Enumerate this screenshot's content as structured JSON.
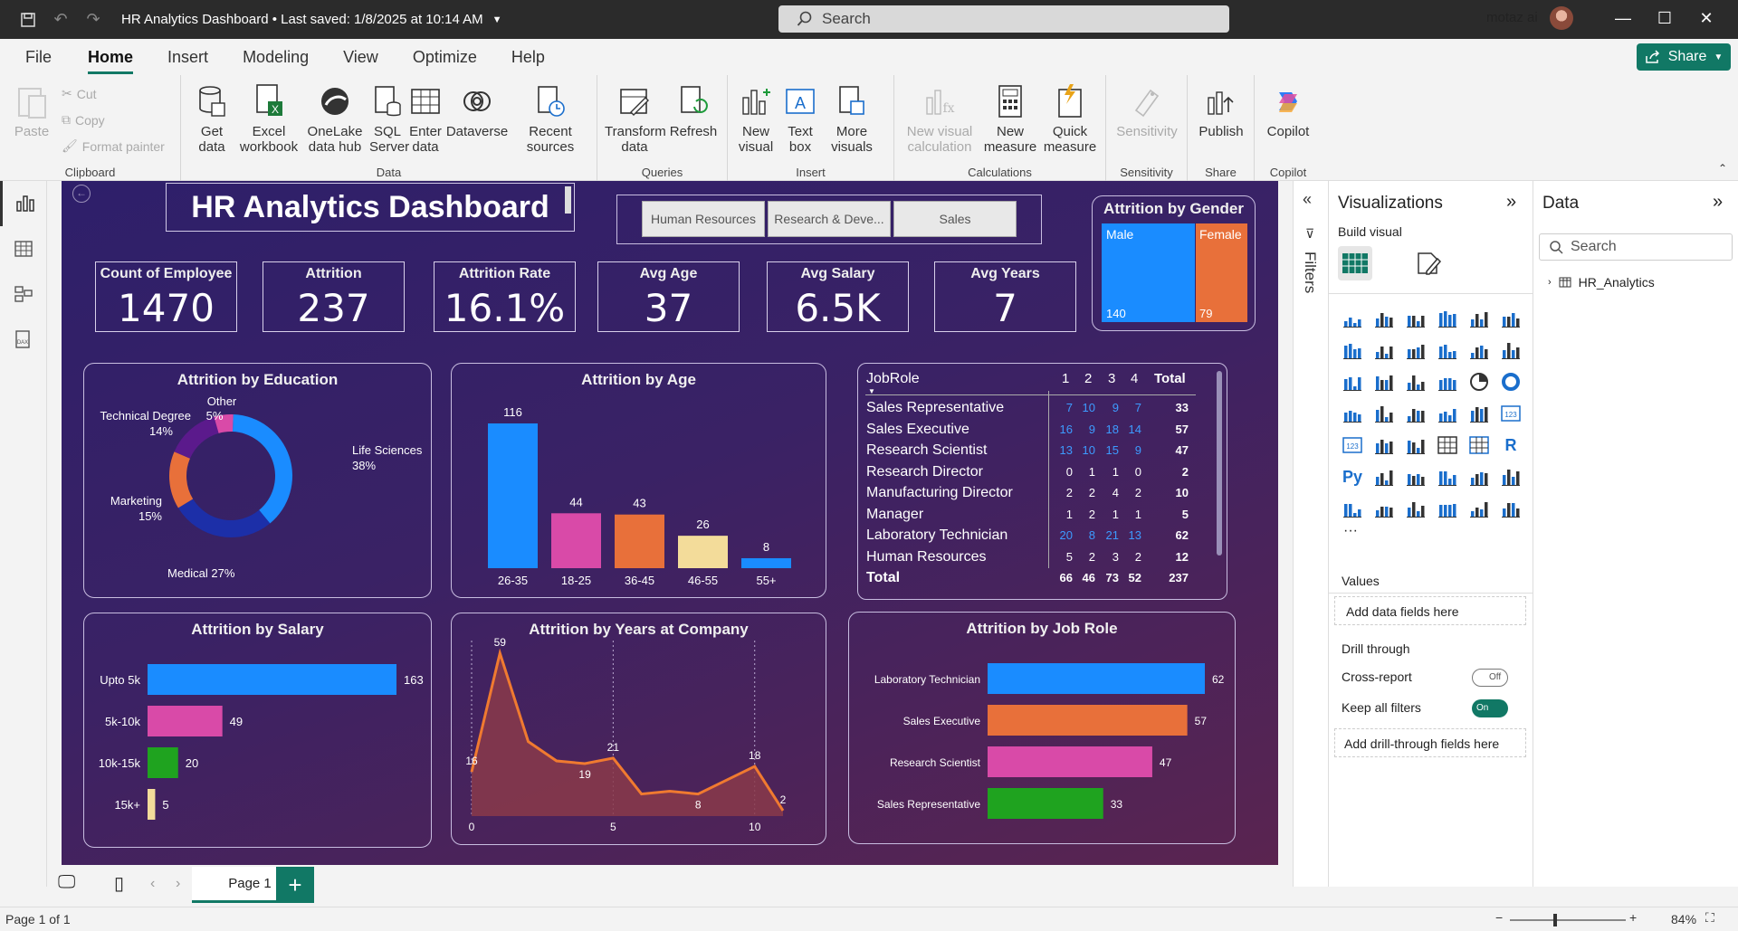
{
  "titlebar": {
    "title": "HR Analytics Dashboard • Last saved: 1/8/2025 at 10:14 AM",
    "search_placeholder": "Search",
    "user": "motaz ai"
  },
  "menu": {
    "file": "File",
    "home": "Home",
    "insert": "Insert",
    "modeling": "Modeling",
    "view": "View",
    "optimize": "Optimize",
    "help": "Help",
    "share": "Share"
  },
  "ribbon": {
    "clipboard": {
      "label": "Clipboard",
      "paste": "Paste",
      "cut": "Cut",
      "copy": "Copy",
      "format_painter": "Format painter"
    },
    "data": {
      "label": "Data",
      "get_data": "Get data",
      "excel": "Excel workbook",
      "onelake": "OneLake data hub",
      "sql": "SQL Server",
      "enter": "Enter data",
      "dataverse": "Dataverse",
      "recent": "Recent sources"
    },
    "queries": {
      "label": "Queries",
      "transform": "Transform data",
      "refresh": "Refresh"
    },
    "insert": {
      "label": "Insert",
      "new_visual": "New visual",
      "text_box": "Text box",
      "more_visuals": "More visuals"
    },
    "calculations": {
      "label": "Calculations",
      "new_visual_calc": "New visual calculation",
      "new_measure": "New measure",
      "quick_measure": "Quick measure"
    },
    "sensitivity": {
      "label": "Sensitivity",
      "sensitivity": "Sensitivity"
    },
    "share": {
      "label": "Share",
      "publish": "Publish"
    },
    "copilot": {
      "label": "Copilot",
      "copilot": "Copilot"
    }
  },
  "dashboard": {
    "title": "HR Analytics Dashboard",
    "slicers": [
      "Human Resources",
      "Research & Deve...",
      "Sales"
    ],
    "kpis": [
      {
        "label": "Count of Employee",
        "value": "1470"
      },
      {
        "label": "Attrition",
        "value": "237"
      },
      {
        "label": "Attrition Rate",
        "value": "16.1%"
      },
      {
        "label": "Avg Age",
        "value": "37"
      },
      {
        "label": "Avg Salary",
        "value": "6.5K"
      },
      {
        "label": "Avg Years",
        "value": "7"
      }
    ],
    "gender": {
      "title": "Attrition by Gender",
      "male_label": "Male",
      "male_value": "140",
      "female_label": "Female",
      "female_value": "79",
      "male_color": "#1a8cff",
      "female_color": "#e8703a"
    },
    "education_title": "Attrition by Education",
    "age_title": "Attrition by Age",
    "salary_title": "Attrition by Salary",
    "years_title": "Attrition by Years at Company",
    "jobrole_title": "Attrition by Job Role",
    "matrix": {
      "col_jobrole": "JobRole",
      "cols": [
        "1",
        "2",
        "3",
        "4",
        "Total"
      ],
      "rows": [
        {
          "role": "Sales Representative",
          "v": [
            "7",
            "10",
            "9",
            "7",
            "33"
          ]
        },
        {
          "role": "Sales Executive",
          "v": [
            "16",
            "9",
            "18",
            "14",
            "57"
          ]
        },
        {
          "role": "Research Scientist",
          "v": [
            "13",
            "10",
            "15",
            "9",
            "47"
          ]
        },
        {
          "role": "Research Director",
          "v": [
            "0",
            "1",
            "1",
            "0",
            "2"
          ]
        },
        {
          "role": "Manufacturing Director",
          "v": [
            "2",
            "2",
            "4",
            "2",
            "10"
          ]
        },
        {
          "role": "Manager",
          "v": [
            "1",
            "2",
            "1",
            "1",
            "5"
          ]
        },
        {
          "role": "Laboratory Technician",
          "v": [
            "20",
            "8",
            "21",
            "13",
            "62"
          ]
        },
        {
          "role": "Human Resources",
          "v": [
            "5",
            "2",
            "3",
            "2",
            "12"
          ]
        }
      ],
      "total_label": "Total",
      "totals": [
        "66",
        "46",
        "73",
        "52",
        "237"
      ]
    }
  },
  "chart_data": [
    {
      "type": "pie",
      "title": "Attrition by Education",
      "categories": [
        "Life Sciences",
        "Medical",
        "Marketing",
        "Technical Degree",
        "Other"
      ],
      "values": [
        38,
        27,
        15,
        14,
        5
      ],
      "labels": [
        "Life Sciences 38%",
        "Medical 27%",
        "Marketing 15%",
        "Technical Degree 14%",
        "Other 5%"
      ],
      "colors": [
        "#1a8cff",
        "#1c2fa8",
        "#e8703a",
        "#5b1a8c",
        "#d94aa8"
      ]
    },
    {
      "type": "bar",
      "title": "Attrition by Age",
      "categories": [
        "26-35",
        "18-25",
        "36-45",
        "46-55",
        "55+"
      ],
      "values": [
        116,
        44,
        43,
        26,
        8
      ],
      "colors": [
        "#1a8cff",
        "#d94aa8",
        "#e8703a",
        "#f3dc9a",
        "#1a8cff"
      ]
    },
    {
      "type": "bar",
      "orientation": "horizontal",
      "title": "Attrition by Salary",
      "categories": [
        "Upto 5k",
        "5k-10k",
        "10k-15k",
        "15k+"
      ],
      "values": [
        163,
        49,
        20,
        5
      ],
      "colors": [
        "#1a8cff",
        "#d94aa8",
        "#1fa31f",
        "#f3dc9a"
      ]
    },
    {
      "type": "area",
      "title": "Attrition by Years at Company",
      "x": [
        0,
        1,
        2,
        3,
        4,
        5,
        6,
        7,
        8,
        9,
        10,
        11
      ],
      "values": [
        16,
        59,
        27,
        20,
        19,
        21,
        8,
        9,
        8,
        13,
        18,
        2
      ],
      "x_ticks": [
        "0",
        "5",
        "10"
      ],
      "labeled": {
        "0": "16",
        "1": "59",
        "4": "19",
        "5": "21",
        "8": "8",
        "10": "18",
        "11": "2"
      }
    },
    {
      "type": "bar",
      "orientation": "horizontal",
      "title": "Attrition by Job Role",
      "categories": [
        "Laboratory Technician",
        "Sales Executive",
        "Research Scientist",
        "Sales Representative"
      ],
      "values": [
        62,
        57,
        47,
        33
      ],
      "colors": [
        "#1a8cff",
        "#e8703a",
        "#d94aa8",
        "#1fa31f"
      ]
    }
  ],
  "filters_label": "Filters",
  "viz_pane": {
    "title": "Visualizations",
    "build": "Build visual",
    "values": "Values",
    "add_fields": "Add data fields here",
    "drill": "Drill through",
    "cross": "Cross-report",
    "cross_state": "Off",
    "keep": "Keep all filters",
    "keep_state": "On",
    "add_drill": "Add drill-through fields here"
  },
  "data_pane": {
    "title": "Data",
    "search": "Search",
    "table": "HR_Analytics"
  },
  "pages": {
    "tab": "Page 1"
  },
  "status": {
    "page": "Page 1 of 1",
    "zoom": "84%"
  }
}
